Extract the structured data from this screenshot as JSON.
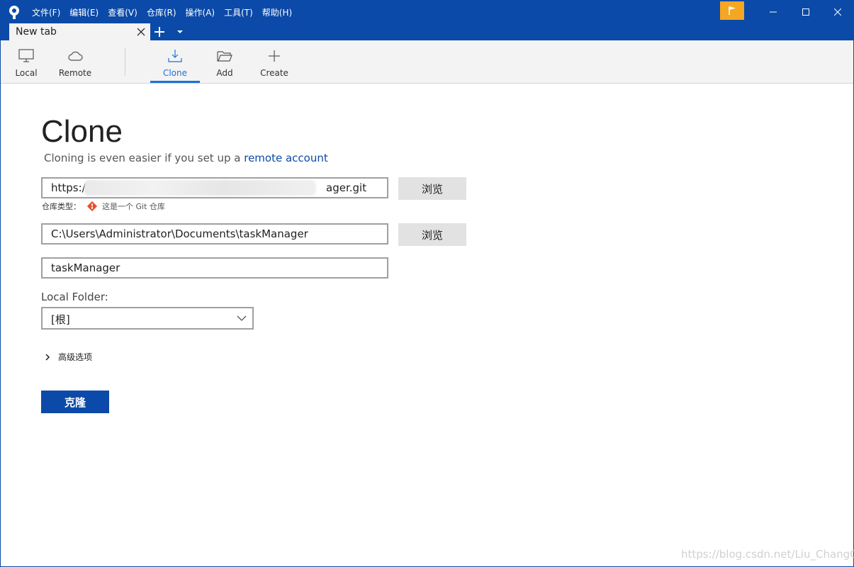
{
  "menu": [
    "文件(F)",
    "编辑(E)",
    "查看(V)",
    "仓库(R)",
    "操作(A)",
    "工具(T)",
    "帮助(H)"
  ],
  "tab": {
    "label": "New tab"
  },
  "toolbar": {
    "local": "Local",
    "remote": "Remote",
    "clone": "Clone",
    "add": "Add",
    "create": "Create"
  },
  "page": {
    "title": "Clone",
    "subtitle_prefix": "Cloning is even easier if you set up a",
    "subtitle_link": "remote account"
  },
  "form": {
    "url_visible_start": "https:/",
    "url_visible_end": "ager.git",
    "browse_label": "浏览",
    "repo_type_label": "仓库类型：",
    "repo_type_value": "这是一个 Git 仓库",
    "path_value": "C:\\Users\\Administrator\\Documents\\taskManager",
    "name_value": "taskManager",
    "local_folder_label": "Local Folder:",
    "local_folder_value": "[根]",
    "advanced_label": "高级选项",
    "clone_button": "克隆"
  },
  "watermark": "https://blog.csdn.net/Liu_ChangC",
  "colors": {
    "accent": "#0b4aa8",
    "active_tab": "#1a73d9",
    "flag": "#f5a623"
  }
}
